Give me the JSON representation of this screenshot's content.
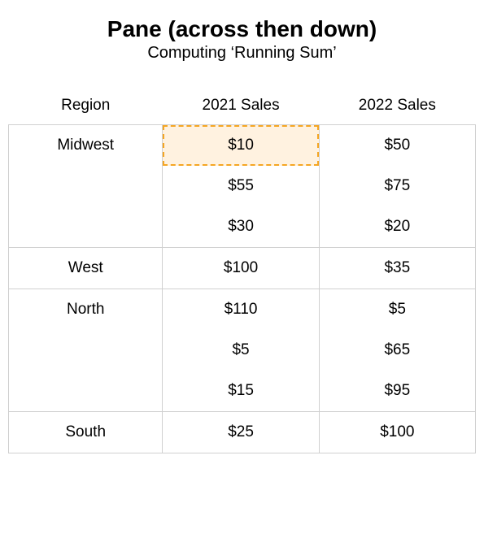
{
  "title": "Pane (across then down)",
  "subtitle": "Computing ‘Running Sum’",
  "headers": {
    "region": "Region",
    "sales2021": "2021 Sales",
    "sales2022": "2022 Sales"
  },
  "rows": [
    {
      "region": "Midwest",
      "s2021": "$10",
      "s2022": "$50",
      "highlight2021": true,
      "groupSize": 3,
      "pos": "start"
    },
    {
      "region": "",
      "s2021": "$55",
      "s2022": "$75",
      "highlight2021": false,
      "pos": "mid"
    },
    {
      "region": "",
      "s2021": "$30",
      "s2022": "$20",
      "highlight2021": false,
      "pos": "end"
    },
    {
      "region": "West",
      "s2021": "$100",
      "s2022": "$35",
      "highlight2021": false,
      "groupSize": 1,
      "pos": "single"
    },
    {
      "region": "North",
      "s2021": "$110",
      "s2022": "$5",
      "highlight2021": false,
      "groupSize": 3,
      "pos": "start"
    },
    {
      "region": "",
      "s2021": "$5",
      "s2022": "$65",
      "highlight2021": false,
      "pos": "mid"
    },
    {
      "region": "",
      "s2021": "$15",
      "s2022": "$95",
      "highlight2021": false,
      "pos": "end"
    },
    {
      "region": "South",
      "s2021": "$25",
      "s2022": "$100",
      "highlight2021": false,
      "groupSize": 1,
      "pos": "single"
    }
  ],
  "chart_data": {
    "type": "table",
    "title": "Pane (across then down) — Computing 'Running Sum'",
    "columns": [
      "Region",
      "2021 Sales",
      "2022 Sales"
    ],
    "groups": [
      {
        "region": "Midwest",
        "rows": [
          {
            "2021": 10,
            "2022": 50
          },
          {
            "2021": 55,
            "2022": 75
          },
          {
            "2021": 30,
            "2022": 20
          }
        ]
      },
      {
        "region": "West",
        "rows": [
          {
            "2021": 100,
            "2022": 35
          }
        ]
      },
      {
        "region": "North",
        "rows": [
          {
            "2021": 110,
            "2022": 5
          },
          {
            "2021": 5,
            "2022": 65
          },
          {
            "2021": 15,
            "2022": 95
          }
        ]
      },
      {
        "region": "South",
        "rows": [
          {
            "2021": 25,
            "2022": 100
          }
        ]
      }
    ],
    "highlighted_cell": {
      "region": "Midwest",
      "row_index": 0,
      "column": "2021 Sales",
      "value": 10
    }
  }
}
